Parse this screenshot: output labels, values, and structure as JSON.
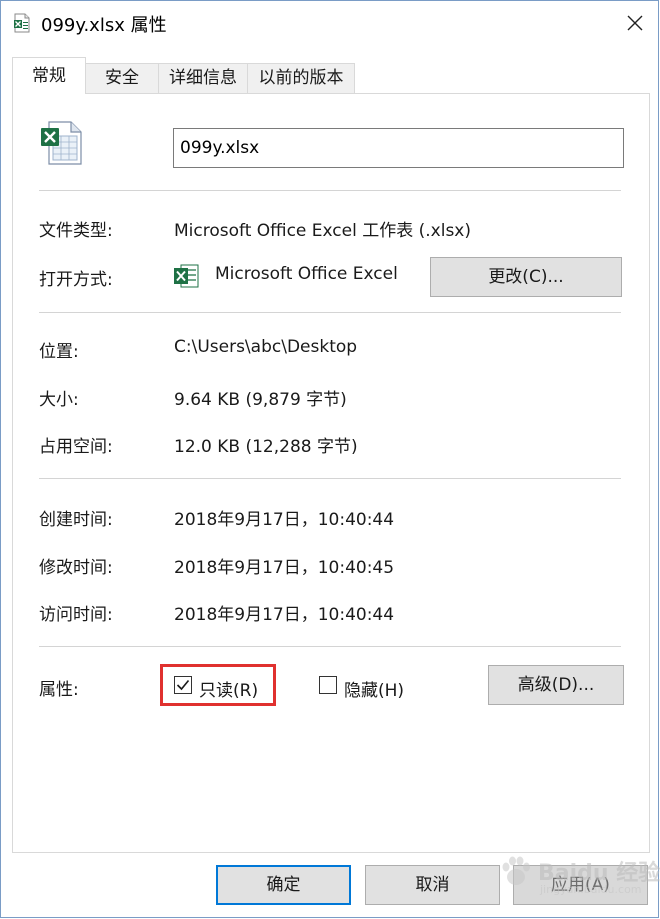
{
  "window": {
    "title": "099y.xlsx 属性",
    "close_icon": "close-icon"
  },
  "tabs": [
    {
      "label": "常规",
      "active": true
    },
    {
      "label": "安全",
      "active": false
    },
    {
      "label": "详细信息",
      "active": false
    },
    {
      "label": "以前的版本",
      "active": false
    }
  ],
  "general": {
    "file_name": "099y.xlsx",
    "file_type_label": "文件类型:",
    "file_type_value": "Microsoft Office Excel 工作表 (.xlsx)",
    "open_with_label": "打开方式:",
    "open_with_value": "Microsoft Office Excel",
    "change_button": "更改(C)...",
    "location_label": "位置:",
    "location_value": "C:\\Users\\abc\\Desktop",
    "size_label": "大小:",
    "size_value": "9.64 KB (9,879 字节)",
    "disk_size_label": "占用空间:",
    "disk_size_value": "12.0 KB (12,288 字节)",
    "created_label": "创建时间:",
    "created_value": "2018年9月17日，10:40:44",
    "modified_label": "修改时间:",
    "modified_value": "2018年9月17日，10:40:45",
    "accessed_label": "访问时间:",
    "accessed_value": "2018年9月17日，10:40:44",
    "attributes_label": "属性:",
    "readonly_label": "只读(R)",
    "readonly_checked": true,
    "hidden_label": "隐藏(H)",
    "hidden_checked": false,
    "advanced_button": "高级(D)..."
  },
  "footer": {
    "ok_button": "确定",
    "cancel_button": "取消",
    "apply_button": "应用(A)"
  },
  "watermark": {
    "text": "Baidu 经验",
    "sub": "jingyan.baidu.com"
  },
  "colors": {
    "accent": "#0078d7",
    "highlight": "#e0312f",
    "excel_green": "#1e7145"
  }
}
